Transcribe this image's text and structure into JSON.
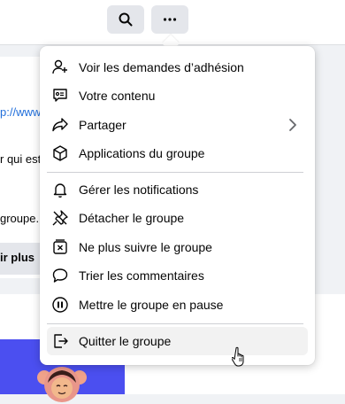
{
  "topbar": {
    "search_icon": "search-icon",
    "more_icon": "more-icon"
  },
  "background": {
    "link_fragment": "p://www",
    "text_fragment_1": "r qui est",
    "text_fragment_2": "groupe.",
    "button_fragment": "ir plus"
  },
  "menu": {
    "items": [
      {
        "label": "Voir les demandes d’adhésion",
        "icon": "person-add-icon"
      },
      {
        "label": "Votre contenu",
        "icon": "content-icon"
      },
      {
        "label": "Partager",
        "icon": "share-icon",
        "has_submenu": true
      },
      {
        "label": "Applications du groupe",
        "icon": "cube-icon"
      },
      {
        "label": "Gérer les notifications",
        "icon": "bell-icon"
      },
      {
        "label": "Détacher le groupe",
        "icon": "unpin-icon"
      },
      {
        "label": "Ne plus suivre le groupe",
        "icon": "unfollow-icon"
      },
      {
        "label": "Trier les commentaires",
        "icon": "comment-icon"
      },
      {
        "label": "Mettre le groupe en pause",
        "icon": "pause-icon"
      },
      {
        "label": "Quitter le groupe",
        "icon": "leave-icon"
      }
    ]
  },
  "colors": {
    "accent": "#1877f2",
    "link": "#216fdb",
    "illustration": "#4b4ff0"
  }
}
